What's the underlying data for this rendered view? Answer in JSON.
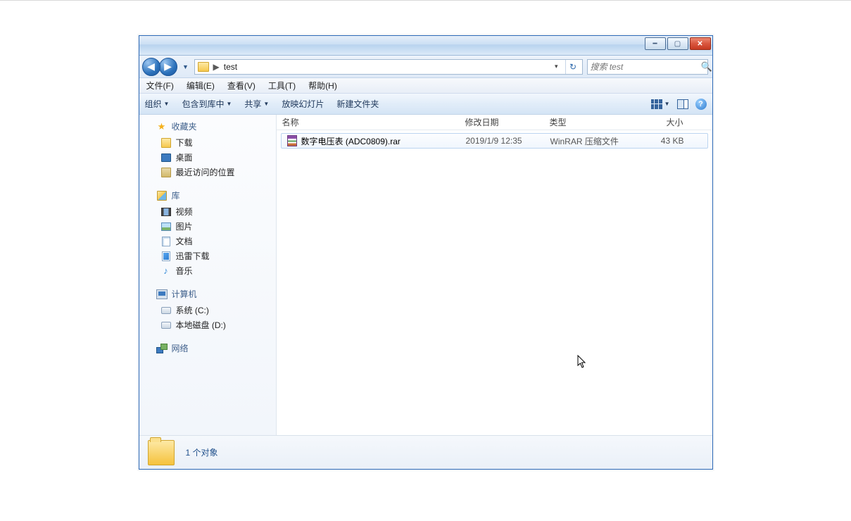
{
  "window": {
    "path_text": "test",
    "search_placeholder": "搜索 test"
  },
  "menubar": {
    "file": "文件(F)",
    "edit": "编辑(E)",
    "view": "查看(V)",
    "tools": "工具(T)",
    "help": "帮助(H)"
  },
  "toolbar": {
    "organize": "组织",
    "include_in_library": "包含到库中",
    "share": "共享",
    "slideshow": "放映幻灯片",
    "new_folder": "新建文件夹"
  },
  "sidebar": {
    "favorites": {
      "label": "收藏夹",
      "items": [
        "下载",
        "桌面",
        "最近访问的位置"
      ]
    },
    "libraries": {
      "label": "库",
      "items": [
        "视频",
        "图片",
        "文档",
        "迅雷下载",
        "音乐"
      ]
    },
    "computer": {
      "label": "计算机",
      "items": [
        "系统 (C:)",
        "本地磁盘 (D:)"
      ]
    },
    "network": {
      "label": "网络"
    }
  },
  "columns": {
    "name": "名称",
    "date": "修改日期",
    "type": "类型",
    "size": "大小"
  },
  "files": [
    {
      "name": "数字电压表 (ADC0809).rar",
      "date": "2019/1/9 12:35",
      "type": "WinRAR 压缩文件",
      "size": "43 KB"
    }
  ],
  "details": {
    "count_text": "1 个对象"
  }
}
